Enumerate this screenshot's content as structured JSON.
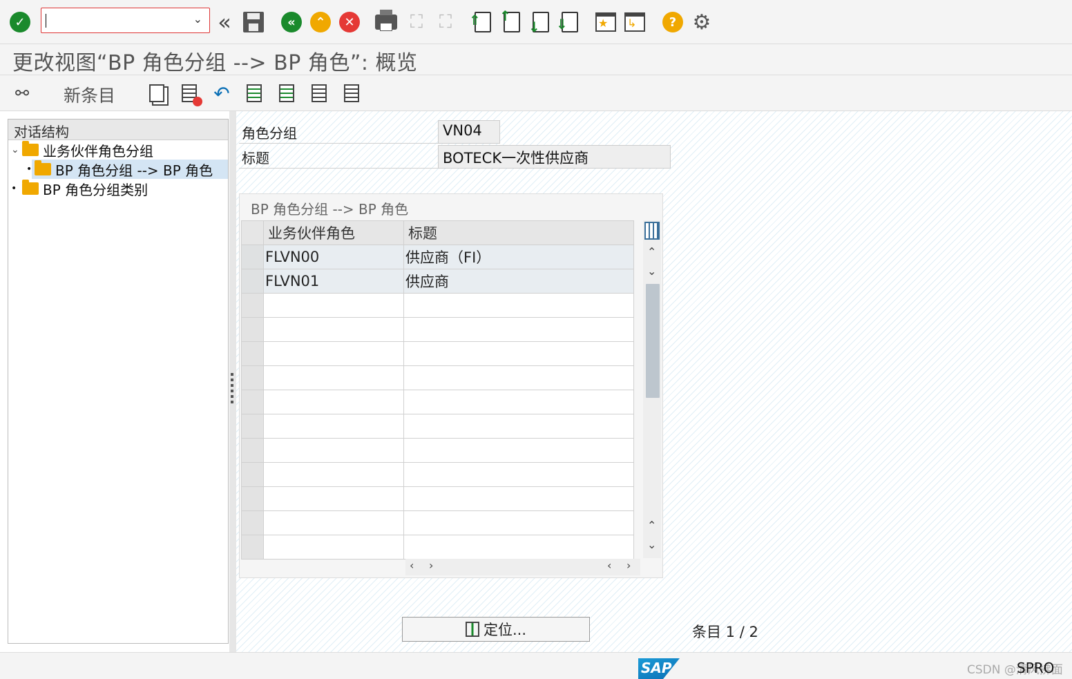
{
  "toolbar": {
    "command_field_value": "",
    "icons": [
      "enter-icon",
      "command-field",
      "back-arrows-icon",
      "save-icon",
      "back-icon",
      "exit-icon",
      "cancel-icon",
      "print-icon",
      "find-icon",
      "find-next-icon",
      "first-page-icon",
      "previous-page-icon",
      "next-page-icon",
      "last-page-icon",
      "new-session-icon",
      "shortcut-icon",
      "help-icon",
      "settings-icon"
    ]
  },
  "title": "更改视图“BP 角色分组 --> BP 角色”: 概览",
  "app_toolbar": {
    "new_entries_label": "新条目",
    "icons": [
      "display-change-icon",
      "copy-as-icon",
      "delete-icon",
      "undo-icon",
      "select-all-icon",
      "select-block-icon",
      "deselect-all-icon",
      "print-field-list-icon"
    ]
  },
  "tree": {
    "header": "对话结构",
    "items": [
      {
        "label": "业务伙伴角色分组",
        "level": 0,
        "expanded": true
      },
      {
        "label": "BP 角色分组 --> BP 角色",
        "level": 1,
        "selected": true
      },
      {
        "label": "BP 角色分组类别",
        "level": 0
      }
    ]
  },
  "fields": {
    "role_group_label": "角色分组",
    "role_group_value": "VN04",
    "title_label": "标题",
    "title_value": "BOTECK一次性供应商"
  },
  "table": {
    "caption": "BP 角色分组 --> BP 角色",
    "columns": [
      "业务伙伴角色",
      "标题"
    ],
    "rows": [
      {
        "role": "FLVN00",
        "title": "供应商（FI）"
      },
      {
        "role": "FLVN01",
        "title": "供应商"
      }
    ],
    "empty_rows": 11
  },
  "locate_button_label": "定位...",
  "entry_count": "条目 1 / 2",
  "status": {
    "logo_text": "SAP",
    "transaction": "SPRO",
    "watermark": "CSDN @清风拂面"
  },
  "colors": {
    "accent_green": "#1a8a2c",
    "accent_orange": "#f0a800",
    "cancel_red": "#e53935",
    "sap_blue": "#0a6fb5"
  }
}
